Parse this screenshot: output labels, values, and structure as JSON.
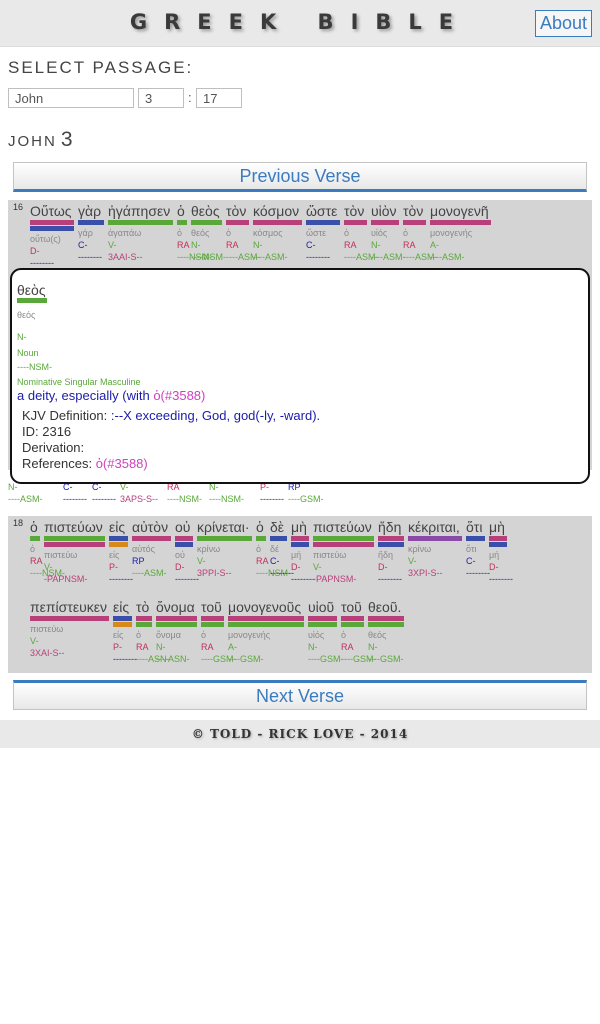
{
  "app": {
    "title": "GREEK BIBLE",
    "about_label": "About"
  },
  "selector": {
    "label": "SELECT PASSAGE:",
    "book": "John",
    "chapter": "3",
    "separator": ":",
    "verse": "17"
  },
  "heading": {
    "book": "JOHN",
    "chapter": "3"
  },
  "nav": {
    "previous": "Previous Verse",
    "next": "Next Verse"
  },
  "colors": {
    "green": "#5aa83a",
    "blue": "#3a4faa",
    "magenta": "#b8407a",
    "red": "#c0305a",
    "orange": "#d58a1a",
    "purple": "#8a4aa8",
    "pink": "#d040c0",
    "link": "#3b7bbf",
    "navy": "#1c1caa"
  },
  "verse16": {
    "number": "16",
    "words": [
      {
        "greek": "Οὕτως",
        "lemma": "οὕτω(ς)",
        "pos": "D-",
        "parse": "--------",
        "bars": [
          "magenta",
          "blue"
        ]
      },
      {
        "greek": "γὰρ",
        "lemma": "γάρ",
        "pos": "C-",
        "parse": "--------",
        "bars": [
          "blue"
        ]
      },
      {
        "greek": "ἠγάπησεν",
        "lemma": "ἀγαπάω",
        "pos": "V-",
        "parse": "3AAI-S--",
        "bars": [
          "green"
        ]
      },
      {
        "greek": "ὁ",
        "lemma": "ὁ",
        "pos": "RA",
        "parse": "----NSM-",
        "bars": [
          "green"
        ]
      },
      {
        "greek": "θεὸς",
        "lemma": "θεός",
        "pos": "N-",
        "parse": "----NSM-",
        "bars": [
          "green"
        ]
      },
      {
        "greek": "τὸν",
        "lemma": "ὁ",
        "pos": "RA",
        "parse": "----ASM-",
        "bars": [
          "magenta"
        ]
      },
      {
        "greek": "κόσμον",
        "lemma": "κόσμος",
        "pos": "N-",
        "parse": "----ASM-",
        "bars": [
          "magenta"
        ]
      },
      {
        "greek": "ὥστε",
        "lemma": "ὥστε",
        "pos": "C-",
        "parse": "--------",
        "bars": [
          "blue"
        ]
      },
      {
        "greek": "τὸν",
        "lemma": "ὁ",
        "pos": "RA",
        "parse": "----ASM-",
        "bars": [
          "magenta"
        ]
      },
      {
        "greek": "υἱὸν",
        "lemma": "υἱός",
        "pos": "N-",
        "parse": "----ASM-",
        "bars": [
          "magenta"
        ]
      },
      {
        "greek": "τὸν",
        "lemma": "ὁ",
        "pos": "RA",
        "parse": "----ASM-",
        "bars": [
          "magenta"
        ]
      },
      {
        "greek": "μονογενῆ",
        "lemma": "μονογενής",
        "pos": "A-",
        "parse": "----ASM-",
        "bars": [
          "magenta"
        ]
      }
    ],
    "partial": [
      {
        "pos": "N-",
        "parse": "----ASM-"
      },
      {
        "pos": "C-",
        "parse": "--------"
      },
      {
        "pos": "C-",
        "parse": "--------"
      },
      {
        "pos": "V-",
        "parse": "3APS-S--"
      },
      {
        "pos": "RA",
        "parse": "----NSM-"
      },
      {
        "pos": "N-",
        "parse": "----NSM-"
      },
      {
        "pos": "P-",
        "parse": "--------"
      },
      {
        "pos": "RP",
        "parse": "----GSM-"
      }
    ]
  },
  "popup": {
    "word": "θεὸς",
    "lemma": "θεός",
    "pos": "N-",
    "pos_name": "Noun",
    "parse": "----NSM-",
    "parse_name": "Nominative Singular Masculine",
    "gloss_prefix": "a deity, especially (with ",
    "gloss_link": "ὁ(#3588)",
    "kjv_label": "KJV Definition: ",
    "kjv_value": ":--X exceeding, God, god(-ly, -ward).",
    "id_label": "ID: ",
    "id_value": "2316",
    "derivation_label": "Derivation:",
    "references_label": "References: ",
    "references_link": "ὁ(#3588)"
  },
  "verse18": {
    "number": "18",
    "words": [
      {
        "greek": "ὁ",
        "lemma": "ὁ",
        "pos": "RA",
        "parse": "----NSM-",
        "bars": [
          "green"
        ]
      },
      {
        "greek": "πιστεύων",
        "lemma": "πιστεύω",
        "pos": "V-",
        "parse": "-PAPNSM-",
        "bars": [
          "green",
          "magenta"
        ]
      },
      {
        "greek": "εἰς",
        "lemma": "εἰς",
        "pos": "P-",
        "parse": "--------",
        "bars": [
          "blue",
          "orange"
        ]
      },
      {
        "greek": "αὐτὸν",
        "lemma": "αὐτός",
        "pos": "RP",
        "parse": "----ASM-",
        "bars": [
          "magenta"
        ]
      },
      {
        "greek": "οὐ",
        "lemma": "οὐ",
        "pos": "D-",
        "parse": "--------",
        "bars": [
          "magenta",
          "blue"
        ]
      },
      {
        "greek": "κρίνεται·",
        "lemma": "κρίνω",
        "pos": "V-",
        "parse": "3PPI-S--",
        "bars": [
          "green"
        ]
      },
      {
        "greek": "ὁ",
        "lemma": "ὁ",
        "pos": "RA",
        "parse": "----NSM-",
        "bars": [
          "green"
        ]
      },
      {
        "greek": "δὲ",
        "lemma": "δέ",
        "pos": "C-",
        "parse": "--------",
        "bars": [
          "blue"
        ]
      },
      {
        "greek": "μὴ",
        "lemma": "μή",
        "pos": "D-",
        "parse": "--------",
        "bars": [
          "magenta",
          "blue"
        ]
      },
      {
        "greek": "πιστεύων",
        "lemma": "πιστεύω",
        "pos": "V-",
        "parse": "-PAPNSM-",
        "bars": [
          "green",
          "magenta"
        ]
      },
      {
        "greek": "ἤδη",
        "lemma": "ἤδη",
        "pos": "D-",
        "parse": "--------",
        "bars": [
          "magenta",
          "blue"
        ]
      },
      {
        "greek": "κέκριται,",
        "lemma": "κρίνω",
        "pos": "V-",
        "parse": "3XPI-S--",
        "bars": [
          "purple"
        ]
      },
      {
        "greek": "ὅτι",
        "lemma": "ὅτι",
        "pos": "C-",
        "parse": "--------",
        "bars": [
          "blue"
        ]
      },
      {
        "greek": "μὴ",
        "lemma": "μή",
        "pos": "D-",
        "parse": "--------",
        "bars": [
          "magenta",
          "blue"
        ]
      },
      {
        "greek": "πεπίστευκεν",
        "lemma": "πιστεύω",
        "pos": "V-",
        "parse": "3XAI-S--",
        "bars": [
          "magenta"
        ]
      },
      {
        "greek": "εἰς",
        "lemma": "εἰς",
        "pos": "P-",
        "parse": "--------",
        "bars": [
          "blue",
          "orange"
        ]
      },
      {
        "greek": "τὸ",
        "lemma": "ὁ",
        "pos": "RA",
        "parse": "----ASN-",
        "bars": [
          "magenta",
          "green"
        ]
      },
      {
        "greek": "ὄνομα",
        "lemma": "ὄνομα",
        "pos": "N-",
        "parse": "----ASN-",
        "bars": [
          "magenta",
          "green"
        ]
      },
      {
        "greek": "τοῦ",
        "lemma": "ὁ",
        "pos": "RA",
        "parse": "----GSM-",
        "bars": [
          "magenta",
          "green"
        ]
      },
      {
        "greek": "μονογενοῦς",
        "lemma": "μονογενής",
        "pos": "A-",
        "parse": "----GSM-",
        "bars": [
          "magenta",
          "green"
        ]
      },
      {
        "greek": "υἱοῦ",
        "lemma": "υἱός",
        "pos": "N-",
        "parse": "----GSM-",
        "bars": [
          "magenta",
          "green"
        ]
      },
      {
        "greek": "τοῦ",
        "lemma": "ὁ",
        "pos": "RA",
        "parse": "----GSM-",
        "bars": [
          "magenta",
          "green"
        ]
      },
      {
        "greek": "θεοῦ.",
        "lemma": "θεός",
        "pos": "N-",
        "parse": "----GSM-",
        "bars": [
          "magenta",
          "green"
        ]
      }
    ]
  },
  "footer": {
    "text": "© TOLD - RICK LOVE - 2014"
  }
}
